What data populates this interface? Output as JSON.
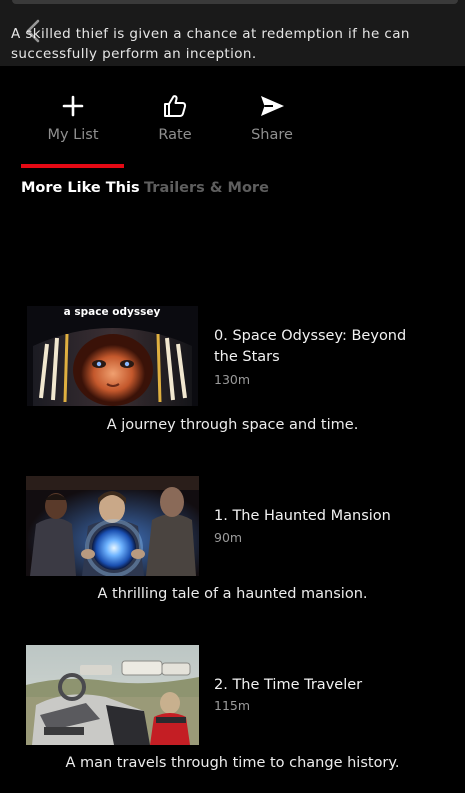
{
  "details": {
    "synopsis": "A skilled thief is given a chance at redemption if he can successfully perform an inception."
  },
  "actions": {
    "my_list_label": "My List",
    "rate_label": "Rate",
    "share_label": "Share"
  },
  "tabs": {
    "more_like_this": "More Like This",
    "trailers_more": "Trailers & More",
    "active": "More Like This",
    "accent_color": "#e50914"
  },
  "similar": [
    {
      "title": "0. Space Odyssey: Beyond the Stars",
      "duration": "130m",
      "description": "A journey through space and time.",
      "thumb_caption": "a space odyssey"
    },
    {
      "title": "1. The Haunted Mansion",
      "duration": "90m",
      "description": "A thrilling tale of a haunted mansion."
    },
    {
      "title": "2. The Time Traveler",
      "duration": "115m",
      "description": "A man travels through time to change history."
    }
  ]
}
